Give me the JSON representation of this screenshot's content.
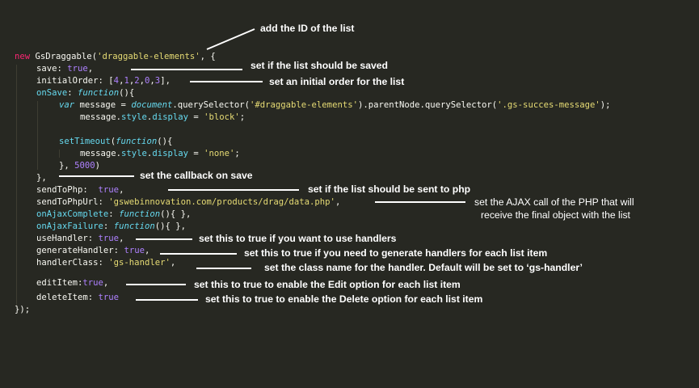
{
  "code": {
    "l1_kw": "new",
    "l1_cls": "GsDraggable(",
    "l1_str": "'draggable-elements'",
    "l1_tail": ", {",
    "l2_key": "save: ",
    "l2_val": "true",
    "l2_tail": ",",
    "l3_key": "initialOrder: [",
    "l3_n1": "4",
    "l3_n2": "1",
    "l3_n3": "2",
    "l3_n4": "0",
    "l3_n5": "3",
    "l3_tail": "],",
    "l4_key": "onSave",
    "l4_colon": ": ",
    "l4_fn": "function",
    "l4_tail": "(){",
    "l5_var": "var",
    "l5_mid": " message = ",
    "l5_doc": "document",
    "l5_qs": ".querySelector(",
    "l5_sel1": "'#draggable-elements'",
    "l5_pn": ").parentNode.querySelector(",
    "l5_sel2": "'.gs-succes-message'",
    "l5_tail": ");",
    "l6_obj": "message.",
    "l6_style": "style",
    "l6_dot": ".",
    "l6_disp": "display",
    "l6_eq": " = ",
    "l6_val": "'block'",
    "l6_tail": ";",
    "l8_st": "setTimeout",
    "l8_paren": "(",
    "l8_fn": "function",
    "l8_tail": "(){",
    "l9_obj": "message.",
    "l9_style": "style",
    "l9_dot": ".",
    "l9_disp": "display",
    "l9_eq": " = ",
    "l9_val": "'none'",
    "l9_tail": ";",
    "l10_head": "}, ",
    "l10_num": "5000",
    "l10_tail": ")",
    "l11": "},",
    "l12_key": "sendToPhp:  ",
    "l12_val": "true",
    "l12_tail": ",",
    "l13_key": "sendToPhpUrl: ",
    "l13_val": "'gswebinnovation.com/products/drag/data.php'",
    "l13_tail": ",",
    "l14_key": "onAjaxComplete",
    "l14_colon": ": ",
    "l14_fn": "function",
    "l14_tail": "(){ },",
    "l15_key": "onAjaxFailure",
    "l15_colon": ": ",
    "l15_fn": "function",
    "l15_tail": "(){ },",
    "l16_key": "useHandler: ",
    "l16_val": "true",
    "l16_tail": ",",
    "l17_key": "generateHandler: ",
    "l17_val": "true",
    "l17_tail": ",",
    "l18_key": "handlerClass: ",
    "l18_val": "'gs-handler'",
    "l18_tail": ",",
    "l19_key": "editItem:",
    "l19_val": "true",
    "l19_tail": ",",
    "l20_key": "deleteItem: ",
    "l20_val": "true",
    "l21": "});"
  },
  "notes": {
    "id": "add the ID of the list",
    "save": "set if the list should be saved",
    "order": "set an initial order for the list",
    "callback": "set the callback on save",
    "php": "set if the list should be sent to php",
    "ajax_line1": "set the AJAX call of the PHP that will",
    "ajax_line2": "receive the final object with the list",
    "handlers": "set this to true if you want to use handlers",
    "generate": "set this to true if you need to generate handlers for each list item",
    "class": "set the class name for the handler. Default will be set to ‘gs-handler’",
    "edit": "set this to true to enable the Edit option for each list item",
    "delete": "set this to true to enable the Delete option for each list item"
  },
  "colors": {
    "background": "#272822",
    "keyword": "#f92672",
    "function": "#66d9ef",
    "string": "#e6db74",
    "number": "#ae81ff",
    "text": "#f8f8f2"
  }
}
